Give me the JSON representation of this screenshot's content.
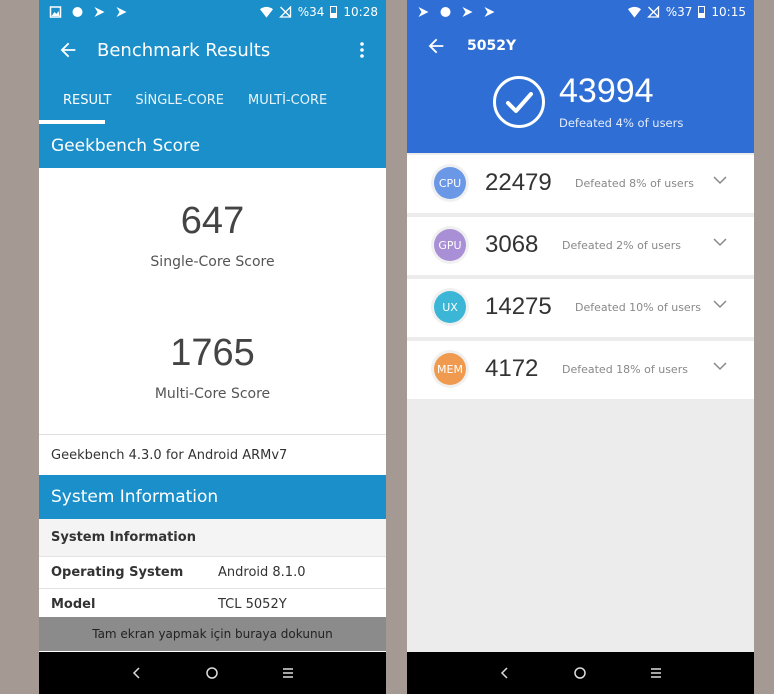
{
  "left": {
    "status": {
      "battery": "%34",
      "time": "10:28"
    },
    "title": "Benchmark Results",
    "tabs": [
      "RESULT",
      "SİNGLE-CORE",
      "MULTİ-CORE"
    ],
    "score_section": "Geekbench Score",
    "single_score": "647",
    "single_label": "Single-Core Score",
    "multi_score": "1765",
    "multi_label": "Multi-Core Score",
    "version": "Geekbench 4.3.0 for Android ARMv7",
    "system_section": "System Information",
    "table_header": "System Information",
    "rows": [
      {
        "key": "Operating System",
        "value": "Android 8.1.0"
      },
      {
        "key": "Model",
        "value": "TCL 5052Y"
      }
    ],
    "toast": "Tam ekran yapmak için buraya dokunun"
  },
  "right": {
    "status": {
      "battery": "%37",
      "time": "10:15"
    },
    "device": "5052Y",
    "total_score": "43994",
    "total_defeated": "Defeated 4% of users",
    "items": [
      {
        "badge": "CPU",
        "score": "22479",
        "defeated": "Defeated 8% of users",
        "color": "#6a97e6"
      },
      {
        "badge": "GPU",
        "score": "3068",
        "defeated": "Defeated 2% of users",
        "color": "#a88fd6"
      },
      {
        "badge": "UX",
        "score": "14275",
        "defeated": "Defeated 10% of users",
        "color": "#3cb6d6"
      },
      {
        "badge": "MEM",
        "score": "4172",
        "defeated": "Defeated 18% of users",
        "color": "#ef9a4e"
      }
    ]
  },
  "colors": {
    "geekbench_blue": "#1b8fca",
    "antutu_blue": "#2f6fd5"
  }
}
